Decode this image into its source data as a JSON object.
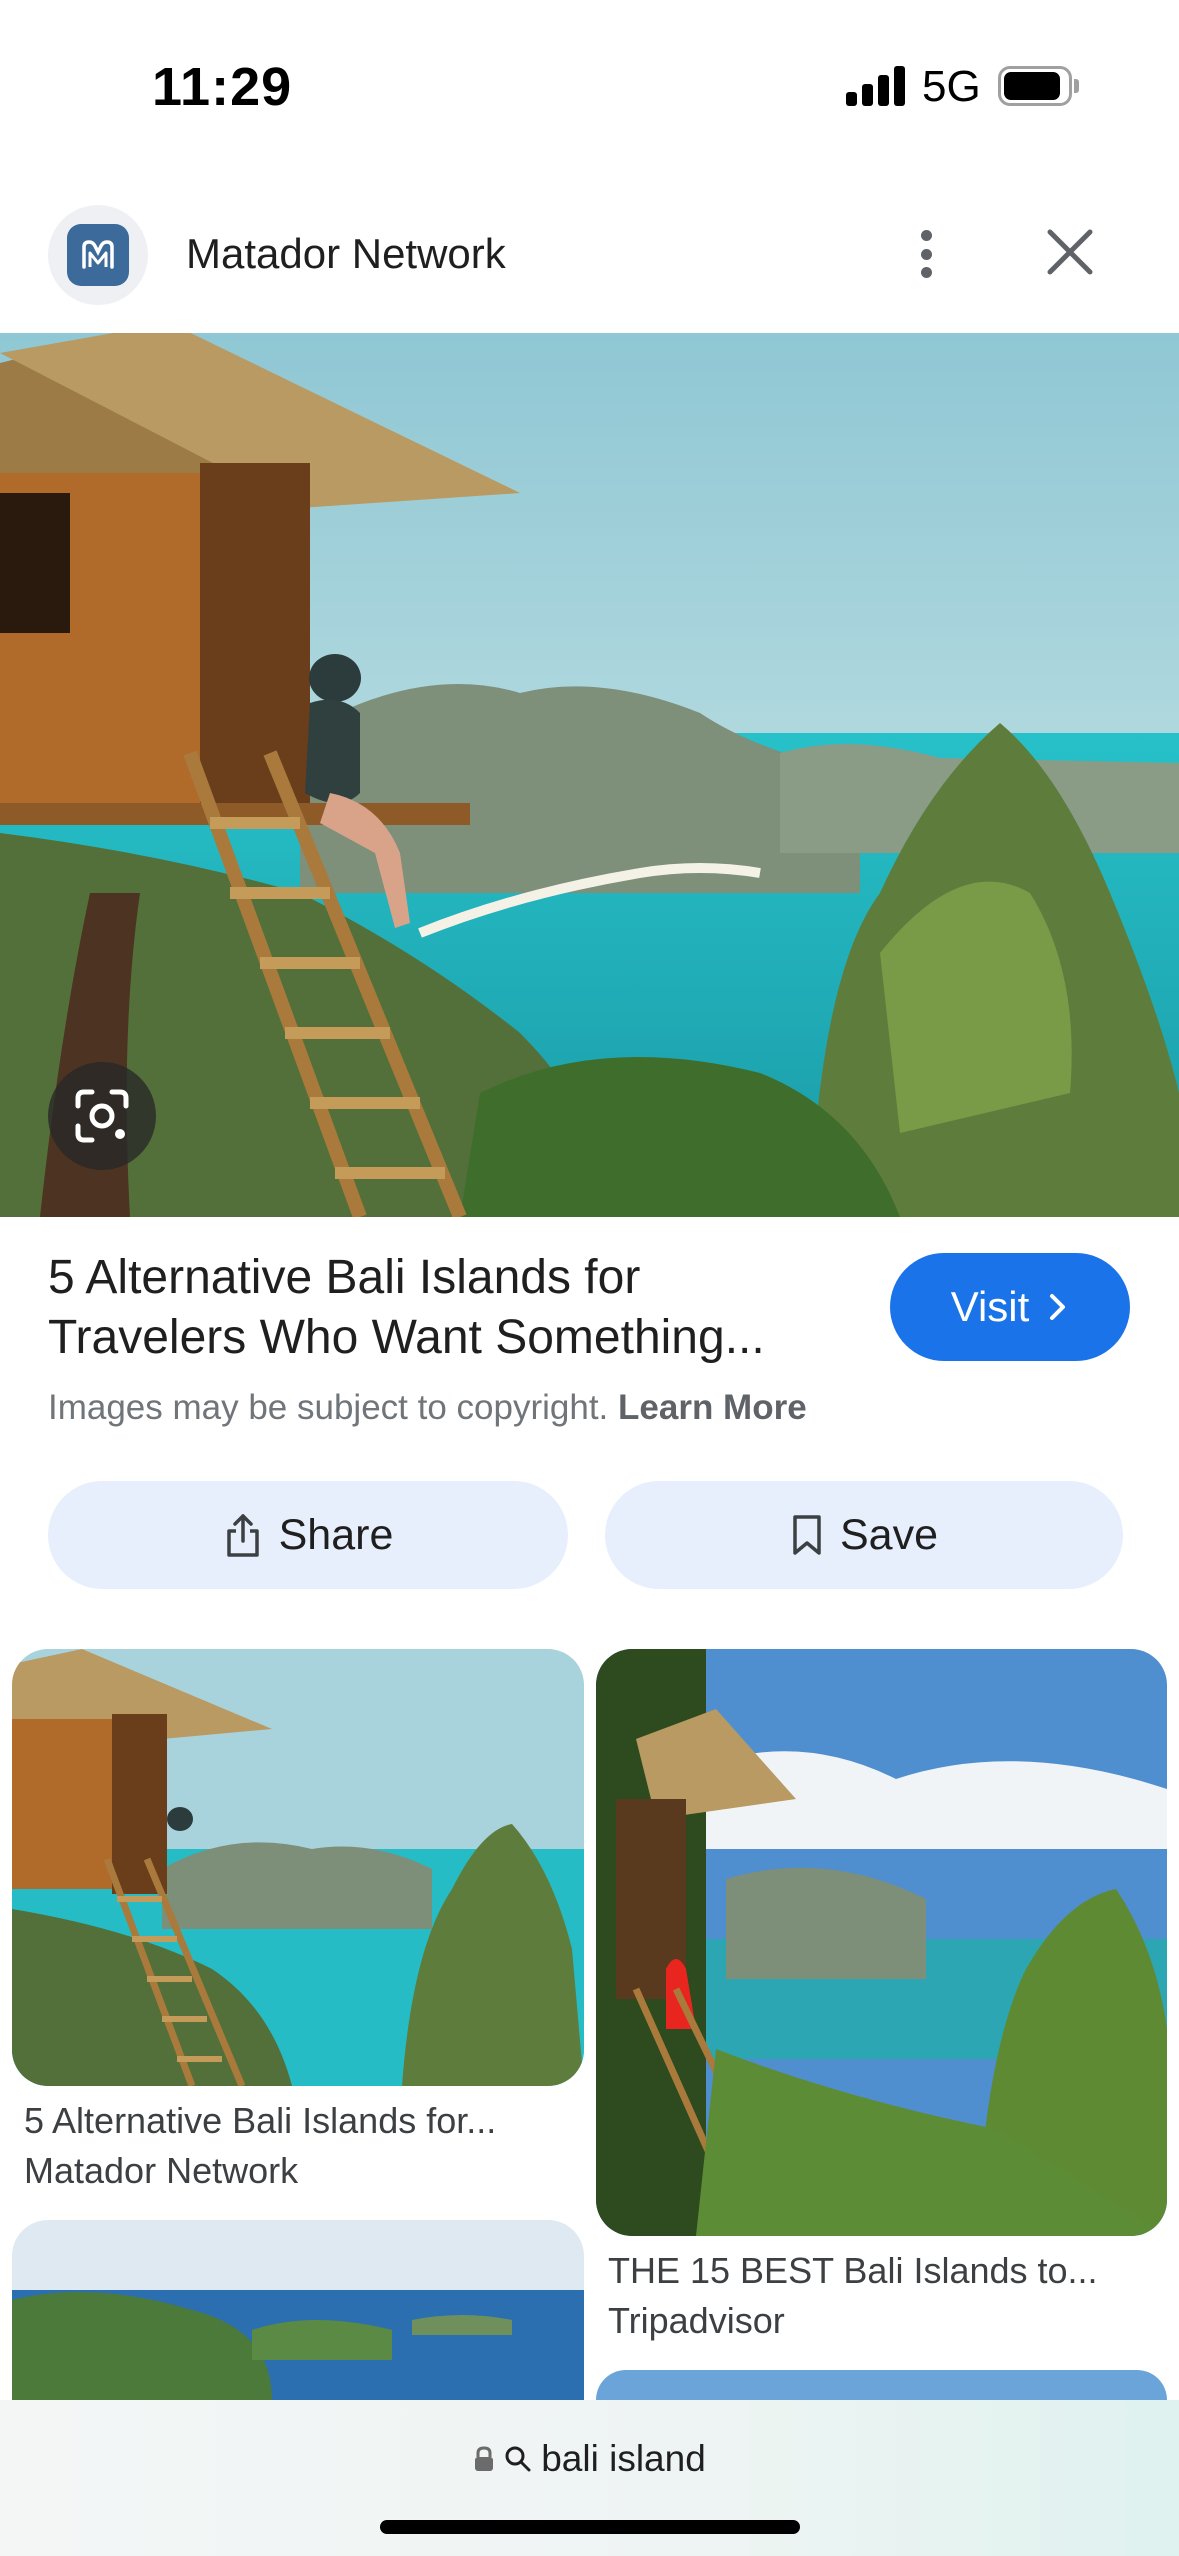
{
  "status_bar": {
    "time": "11:29",
    "network": "5G"
  },
  "header": {
    "site_name": "Matador Network",
    "logo_icon": "matador-logo-icon",
    "more_icon": "more-vert-icon",
    "close_icon": "close-icon"
  },
  "result": {
    "title_line1": "5 Alternative Bali Islands for",
    "title_line2": "Travelers Who Want Something...",
    "visit_label": "Visit",
    "copyright_text": "Images may be subject to copyright.",
    "learn_more": "Learn More"
  },
  "actions": {
    "share_label": "Share",
    "save_label": "Save"
  },
  "related": [
    {
      "title": "5 Alternative Bali Islands for...",
      "source": "Matador Network"
    },
    {
      "title": "THE 15 BEST Bali Islands to...",
      "source": "Tripadvisor"
    }
  ],
  "address_bar": {
    "query": "bali island"
  },
  "colors": {
    "accent": "#1a73e8",
    "action_bg": "#e8effc",
    "sea": "#2fc3c8"
  }
}
